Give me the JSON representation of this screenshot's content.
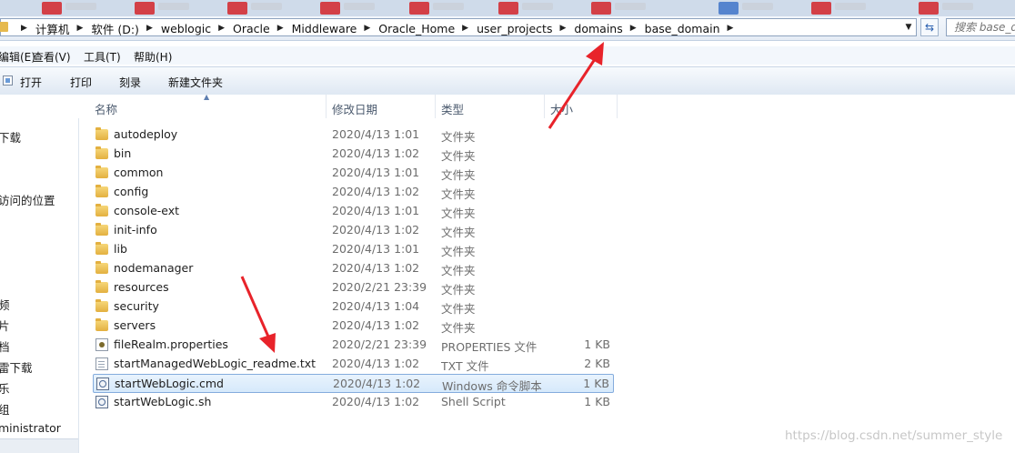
{
  "address": {
    "crumbs": [
      "计算机",
      "软件 (D:)",
      "weblogic",
      "Oracle",
      "Middleware",
      "Oracle_Home",
      "user_projects",
      "domains",
      "base_domain"
    ],
    "search_placeholder": "搜索 base_d"
  },
  "menubar": {
    "items": [
      "编辑(E)",
      "查看(V)",
      "工具(T)",
      "帮助(H)"
    ]
  },
  "toolbar": {
    "open": "打开",
    "print": "打印",
    "burn": "刻录",
    "new_folder": "新建文件夹"
  },
  "navpane": {
    "items": [
      "下载",
      "访问的位置",
      "频",
      "片",
      "档",
      "雷下载",
      "乐",
      "组",
      "ministrator"
    ]
  },
  "columns": {
    "name": "名称",
    "date": "修改日期",
    "type": "类型",
    "size": "大小"
  },
  "files": [
    {
      "name": "autodeploy",
      "date": "2020/4/13 1:01",
      "type": "文件夹",
      "size": "",
      "icon": "folder-icon"
    },
    {
      "name": "bin",
      "date": "2020/4/13 1:02",
      "type": "文件夹",
      "size": "",
      "icon": "folder-icon"
    },
    {
      "name": "common",
      "date": "2020/4/13 1:01",
      "type": "文件夹",
      "size": "",
      "icon": "folder-icon"
    },
    {
      "name": "config",
      "date": "2020/4/13 1:02",
      "type": "文件夹",
      "size": "",
      "icon": "folder-icon"
    },
    {
      "name": "console-ext",
      "date": "2020/4/13 1:01",
      "type": "文件夹",
      "size": "",
      "icon": "folder-icon"
    },
    {
      "name": "init-info",
      "date": "2020/4/13 1:02",
      "type": "文件夹",
      "size": "",
      "icon": "folder-icon"
    },
    {
      "name": "lib",
      "date": "2020/4/13 1:01",
      "type": "文件夹",
      "size": "",
      "icon": "folder-icon"
    },
    {
      "name": "nodemanager",
      "date": "2020/4/13 1:02",
      "type": "文件夹",
      "size": "",
      "icon": "folder-icon"
    },
    {
      "name": "resources",
      "date": "2020/2/21 23:39",
      "type": "文件夹",
      "size": "",
      "icon": "folder-icon"
    },
    {
      "name": "security",
      "date": "2020/4/13 1:04",
      "type": "文件夹",
      "size": "",
      "icon": "folder-icon"
    },
    {
      "name": "servers",
      "date": "2020/4/13 1:02",
      "type": "文件夹",
      "size": "",
      "icon": "folder-icon"
    },
    {
      "name": "fileRealm.properties",
      "date": "2020/2/21 23:39",
      "type": "PROPERTIES 文件",
      "size": "1 KB",
      "icon": "properties-file-icon"
    },
    {
      "name": "startManagedWebLogic_readme.txt",
      "date": "2020/4/13 1:02",
      "type": "TXT 文件",
      "size": "2 KB",
      "icon": "text-file-icon"
    },
    {
      "name": "startWebLogic.cmd",
      "date": "2020/4/13 1:02",
      "type": "Windows 命令脚本",
      "size": "1 KB",
      "icon": "cmd-script-icon",
      "selected": true
    },
    {
      "name": "startWebLogic.sh",
      "date": "2020/4/13 1:02",
      "type": "Shell Script",
      "size": "1 KB",
      "icon": "cmd-script-icon"
    }
  ],
  "watermark": "https://blog.csdn.net/summer_style",
  "colors": {
    "annotation_arrow": "#e8232a",
    "selection": "#d6e9fb"
  }
}
